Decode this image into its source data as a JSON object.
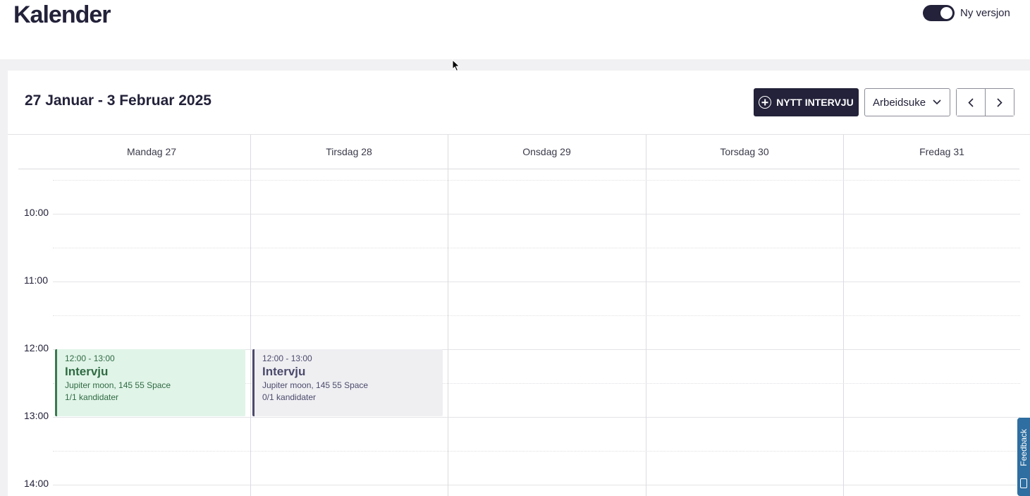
{
  "page": {
    "title": "Kalender"
  },
  "toggle": {
    "label": "Ny versjon",
    "enabled": true
  },
  "calendar": {
    "week_range": "27 Januar - 3 Februar 2025",
    "new_interview_label": "NYTT INTERVJU",
    "view_select": {
      "selected": "Arbeidsuke"
    },
    "days": [
      {
        "label": "Mandag 27"
      },
      {
        "label": "Tirsdag 28"
      },
      {
        "label": "Onsdag 29"
      },
      {
        "label": "Torsdag 30"
      },
      {
        "label": "Fredag 31"
      }
    ],
    "times": [
      "10:00",
      "11:00",
      "12:00",
      "13:00",
      "14:00"
    ],
    "events": [
      {
        "time": "12:00 - 13:00",
        "title": "Intervju",
        "location": "Jupiter moon, 145 55 Space",
        "candidates": "1/1 kandidater",
        "status_color": "#3a7a4f"
      },
      {
        "time": "12:00 - 13:00",
        "title": "Intervju",
        "location": "Jupiter moon, 145 55 Space",
        "candidates": "0/1 kandidater",
        "status_color": "#4b4a6c"
      }
    ]
  },
  "feedback": {
    "label": "Feedback"
  },
  "colors": {
    "primary": "#23223a",
    "accent_green": "#e1f4e8",
    "feedback_blue": "#2e6ea0"
  }
}
